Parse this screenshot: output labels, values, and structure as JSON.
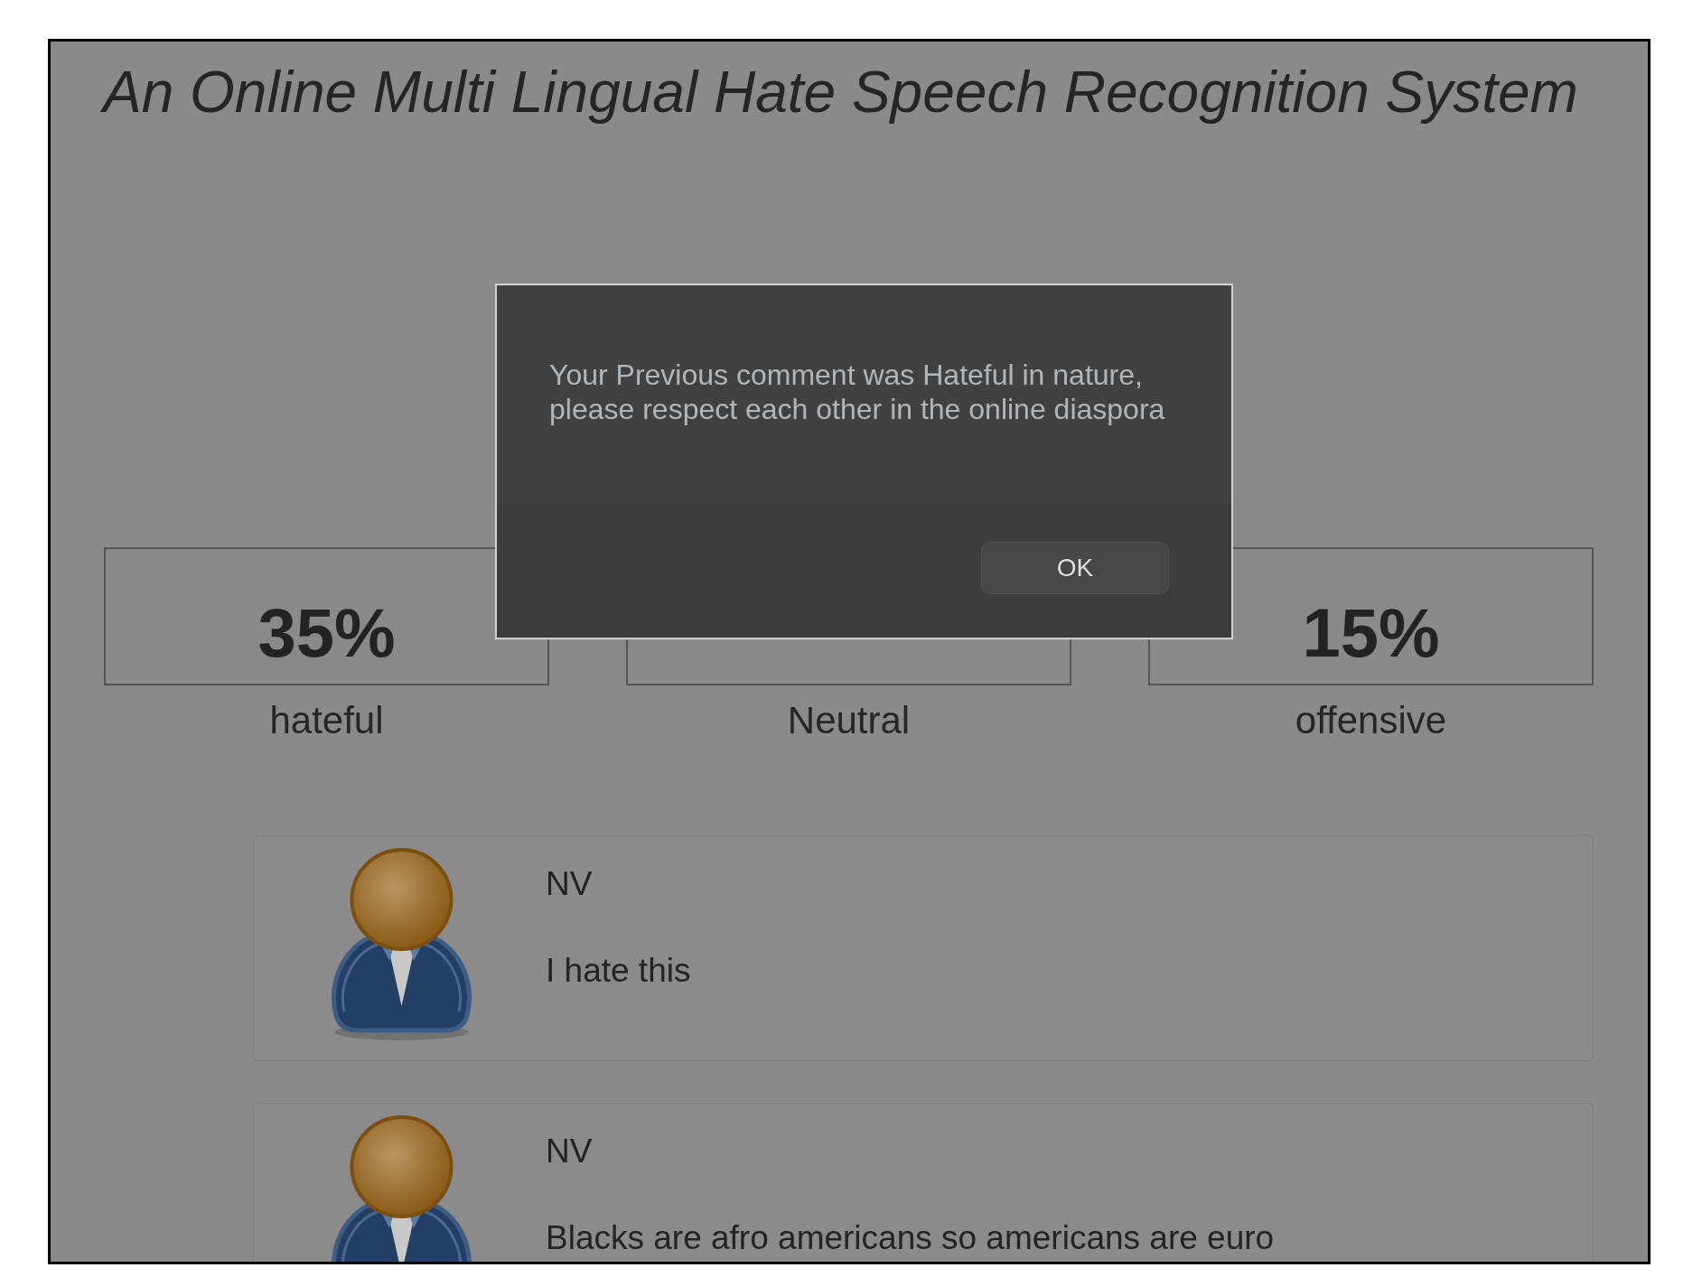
{
  "title": "An Online Multi Lingual Hate Speech Recognition System",
  "stats": [
    {
      "value": "35%",
      "label": "hateful"
    },
    {
      "label": "Neutral"
    },
    {
      "value": "15%",
      "label": "offensive"
    }
  ],
  "comments": [
    {
      "author": "NV",
      "text": "I hate this"
    },
    {
      "author": "NV",
      "text": "Blacks are afro americans so americans are euro"
    }
  ],
  "modal": {
    "message": "Your Previous comment was Hateful in nature, please respect each other in the online diaspora",
    "buttons": [
      "OK"
    ]
  }
}
